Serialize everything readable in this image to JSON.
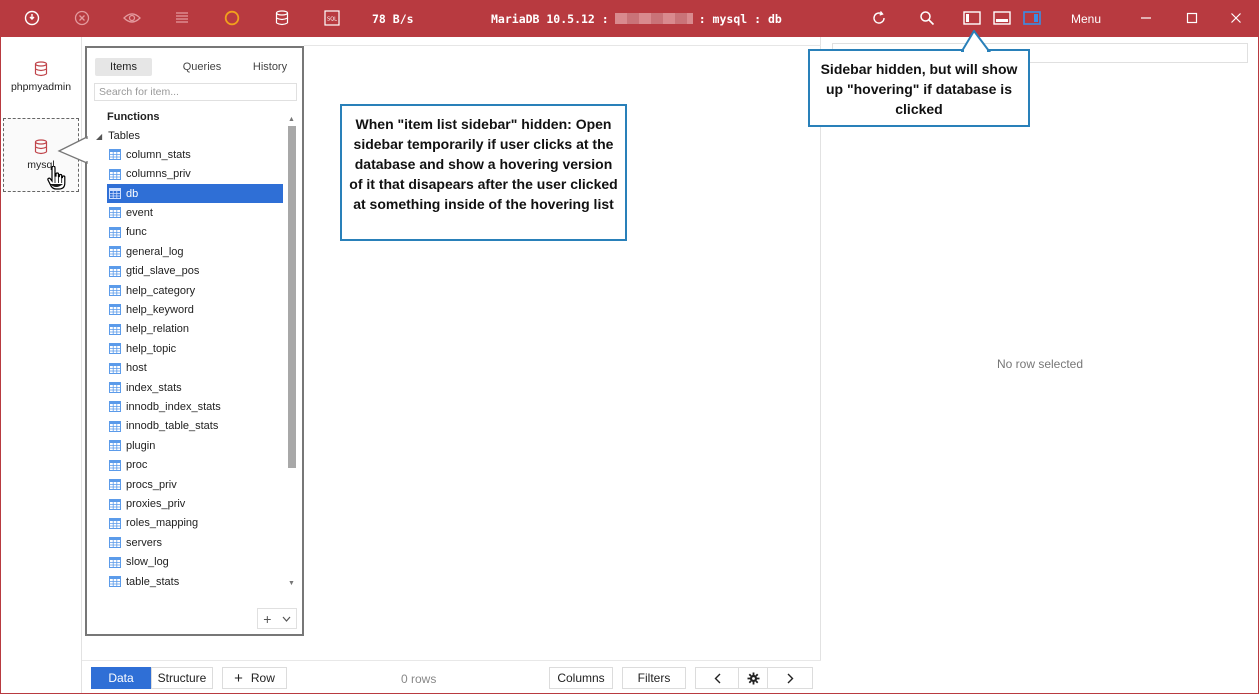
{
  "titlebar": {
    "speed": "78 B/s",
    "title_server": "MariaDB 10.5.12 :",
    "title_path": ": mysql : db",
    "menu_label": "Menu"
  },
  "rail": {
    "items": [
      {
        "label": "phpmyadmin"
      },
      {
        "label": "mysql"
      }
    ]
  },
  "sidebar": {
    "tabs": [
      "Items",
      "Queries",
      "History"
    ],
    "search_placeholder": "Search for item...",
    "functions_label": "Functions",
    "tables_label": "Tables",
    "tables": [
      "column_stats",
      "columns_priv",
      "db",
      "event",
      "func",
      "general_log",
      "gtid_slave_pos",
      "help_category",
      "help_keyword",
      "help_relation",
      "help_topic",
      "host",
      "index_stats",
      "innodb_index_stats",
      "innodb_table_stats",
      "plugin",
      "proc",
      "procs_priv",
      "proxies_priv",
      "roles_mapping",
      "servers",
      "slow_log",
      "table_stats"
    ],
    "selected_table": "db"
  },
  "callouts": {
    "left": "When \"item list sidebar\" hidden: Open sidebar temporarily if user clicks at the database and show a hovering version of it that disapears after the user clicked at something inside of the hovering list",
    "right": "Sidebar hidden, but will show up \"hovering\" if database is clicked"
  },
  "right_panel": {
    "empty_text": "No row selected"
  },
  "bottombar": {
    "data_label": "Data",
    "structure_label": "Structure",
    "row_label": "Row",
    "rows_count": "0 rows",
    "columns_label": "Columns",
    "filters_label": "Filters"
  },
  "colors": {
    "titlebar": "#b83a40",
    "accent": "#2f6fd6",
    "callout_border": "#2980b9"
  }
}
